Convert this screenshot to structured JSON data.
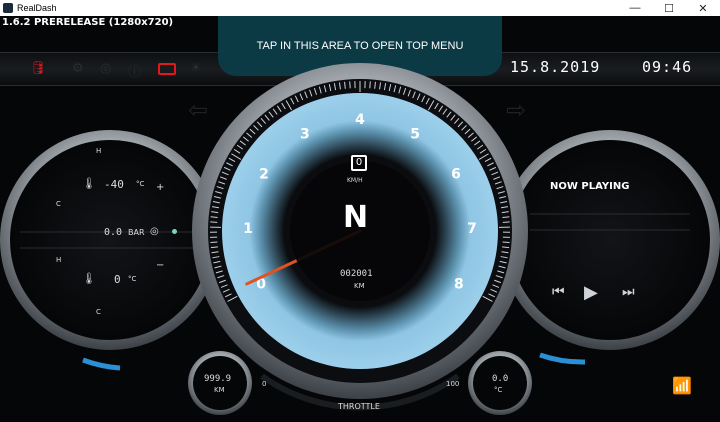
{
  "window": {
    "title": "RealDash",
    "minimize": "—",
    "maximize": "☐",
    "close": "✕"
  },
  "version": "1.6.2 PRERELEASE (1280x720)",
  "top_menu_hint": "TAP IN THIS AREA TO OPEN TOP MENU",
  "date": "15.8.2019",
  "time": "09:46",
  "colors": {
    "accent_blue": "#8fc6e4",
    "needle": "#e0521f",
    "warning_red": "#e0191b",
    "wifi": "#2b8fd6"
  },
  "warning_icons": [
    "oil-pressure-icon",
    "engine-icon",
    "brake-icon",
    "battery-icon",
    "light-icon"
  ],
  "left_gauge": {
    "coolant_temp": "-40",
    "coolant_unit": "°C",
    "pressure": "0.0",
    "pressure_unit": "BAR",
    "oil_temp": "0",
    "oil_unit": "°C",
    "h_label": "H",
    "c_label": "C",
    "plus": "+",
    "minus": "−"
  },
  "center_gauge": {
    "ticks": [
      "0",
      "1",
      "2",
      "3",
      "4",
      "5",
      "6",
      "7",
      "8"
    ],
    "speed": "0",
    "speed_unit": "KM/H",
    "gear": "N",
    "odometer": "002001",
    "odometer_unit": "KM",
    "rpm_value": 0.1
  },
  "right_gauge": {
    "now_playing": "NOW PLAYING"
  },
  "trip": {
    "value": "999.9",
    "unit": "KM"
  },
  "temp": {
    "value": "0.0",
    "unit": "°C"
  },
  "throttle": {
    "label": "THROTTLE",
    "min": "0",
    "max": "100",
    "value": 0
  }
}
